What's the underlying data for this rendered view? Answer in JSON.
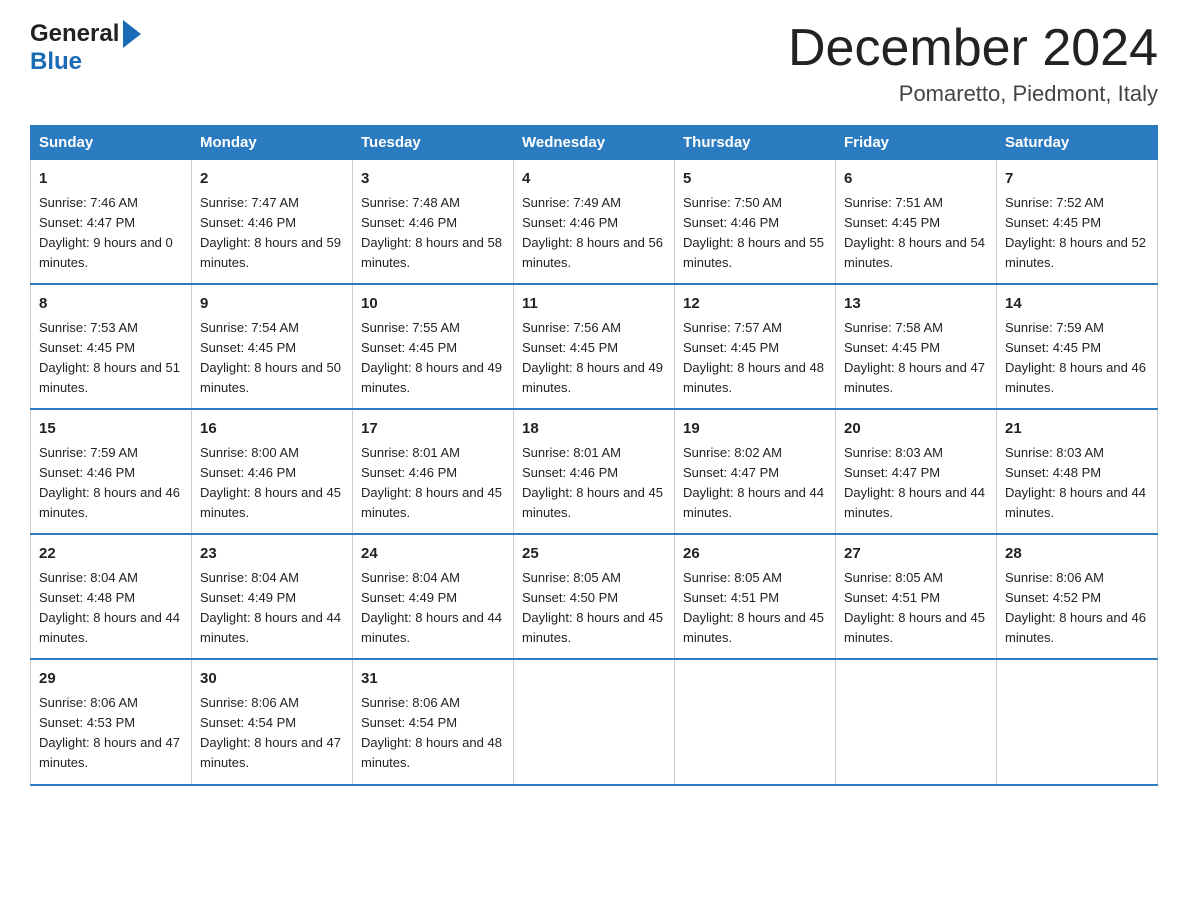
{
  "logo": {
    "general": "General",
    "blue": "Blue"
  },
  "header": {
    "month": "December 2024",
    "location": "Pomaretto, Piedmont, Italy"
  },
  "days_of_week": [
    "Sunday",
    "Monday",
    "Tuesday",
    "Wednesday",
    "Thursday",
    "Friday",
    "Saturday"
  ],
  "weeks": [
    [
      {
        "day": "1",
        "sunrise": "7:46 AM",
        "sunset": "4:47 PM",
        "daylight": "9 hours and 0 minutes."
      },
      {
        "day": "2",
        "sunrise": "7:47 AM",
        "sunset": "4:46 PM",
        "daylight": "8 hours and 59 minutes."
      },
      {
        "day": "3",
        "sunrise": "7:48 AM",
        "sunset": "4:46 PM",
        "daylight": "8 hours and 58 minutes."
      },
      {
        "day": "4",
        "sunrise": "7:49 AM",
        "sunset": "4:46 PM",
        "daylight": "8 hours and 56 minutes."
      },
      {
        "day": "5",
        "sunrise": "7:50 AM",
        "sunset": "4:46 PM",
        "daylight": "8 hours and 55 minutes."
      },
      {
        "day": "6",
        "sunrise": "7:51 AM",
        "sunset": "4:45 PM",
        "daylight": "8 hours and 54 minutes."
      },
      {
        "day": "7",
        "sunrise": "7:52 AM",
        "sunset": "4:45 PM",
        "daylight": "8 hours and 52 minutes."
      }
    ],
    [
      {
        "day": "8",
        "sunrise": "7:53 AM",
        "sunset": "4:45 PM",
        "daylight": "8 hours and 51 minutes."
      },
      {
        "day": "9",
        "sunrise": "7:54 AM",
        "sunset": "4:45 PM",
        "daylight": "8 hours and 50 minutes."
      },
      {
        "day": "10",
        "sunrise": "7:55 AM",
        "sunset": "4:45 PM",
        "daylight": "8 hours and 49 minutes."
      },
      {
        "day": "11",
        "sunrise": "7:56 AM",
        "sunset": "4:45 PM",
        "daylight": "8 hours and 49 minutes."
      },
      {
        "day": "12",
        "sunrise": "7:57 AM",
        "sunset": "4:45 PM",
        "daylight": "8 hours and 48 minutes."
      },
      {
        "day": "13",
        "sunrise": "7:58 AM",
        "sunset": "4:45 PM",
        "daylight": "8 hours and 47 minutes."
      },
      {
        "day": "14",
        "sunrise": "7:59 AM",
        "sunset": "4:45 PM",
        "daylight": "8 hours and 46 minutes."
      }
    ],
    [
      {
        "day": "15",
        "sunrise": "7:59 AM",
        "sunset": "4:46 PM",
        "daylight": "8 hours and 46 minutes."
      },
      {
        "day": "16",
        "sunrise": "8:00 AM",
        "sunset": "4:46 PM",
        "daylight": "8 hours and 45 minutes."
      },
      {
        "day": "17",
        "sunrise": "8:01 AM",
        "sunset": "4:46 PM",
        "daylight": "8 hours and 45 minutes."
      },
      {
        "day": "18",
        "sunrise": "8:01 AM",
        "sunset": "4:46 PM",
        "daylight": "8 hours and 45 minutes."
      },
      {
        "day": "19",
        "sunrise": "8:02 AM",
        "sunset": "4:47 PM",
        "daylight": "8 hours and 44 minutes."
      },
      {
        "day": "20",
        "sunrise": "8:03 AM",
        "sunset": "4:47 PM",
        "daylight": "8 hours and 44 minutes."
      },
      {
        "day": "21",
        "sunrise": "8:03 AM",
        "sunset": "4:48 PM",
        "daylight": "8 hours and 44 minutes."
      }
    ],
    [
      {
        "day": "22",
        "sunrise": "8:04 AM",
        "sunset": "4:48 PM",
        "daylight": "8 hours and 44 minutes."
      },
      {
        "day": "23",
        "sunrise": "8:04 AM",
        "sunset": "4:49 PM",
        "daylight": "8 hours and 44 minutes."
      },
      {
        "day": "24",
        "sunrise": "8:04 AM",
        "sunset": "4:49 PM",
        "daylight": "8 hours and 44 minutes."
      },
      {
        "day": "25",
        "sunrise": "8:05 AM",
        "sunset": "4:50 PM",
        "daylight": "8 hours and 45 minutes."
      },
      {
        "day": "26",
        "sunrise": "8:05 AM",
        "sunset": "4:51 PM",
        "daylight": "8 hours and 45 minutes."
      },
      {
        "day": "27",
        "sunrise": "8:05 AM",
        "sunset": "4:51 PM",
        "daylight": "8 hours and 45 minutes."
      },
      {
        "day": "28",
        "sunrise": "8:06 AM",
        "sunset": "4:52 PM",
        "daylight": "8 hours and 46 minutes."
      }
    ],
    [
      {
        "day": "29",
        "sunrise": "8:06 AM",
        "sunset": "4:53 PM",
        "daylight": "8 hours and 47 minutes."
      },
      {
        "day": "30",
        "sunrise": "8:06 AM",
        "sunset": "4:54 PM",
        "daylight": "8 hours and 47 minutes."
      },
      {
        "day": "31",
        "sunrise": "8:06 AM",
        "sunset": "4:54 PM",
        "daylight": "8 hours and 48 minutes."
      },
      null,
      null,
      null,
      null
    ]
  ],
  "labels": {
    "sunrise": "Sunrise:",
    "sunset": "Sunset:",
    "daylight": "Daylight:"
  }
}
